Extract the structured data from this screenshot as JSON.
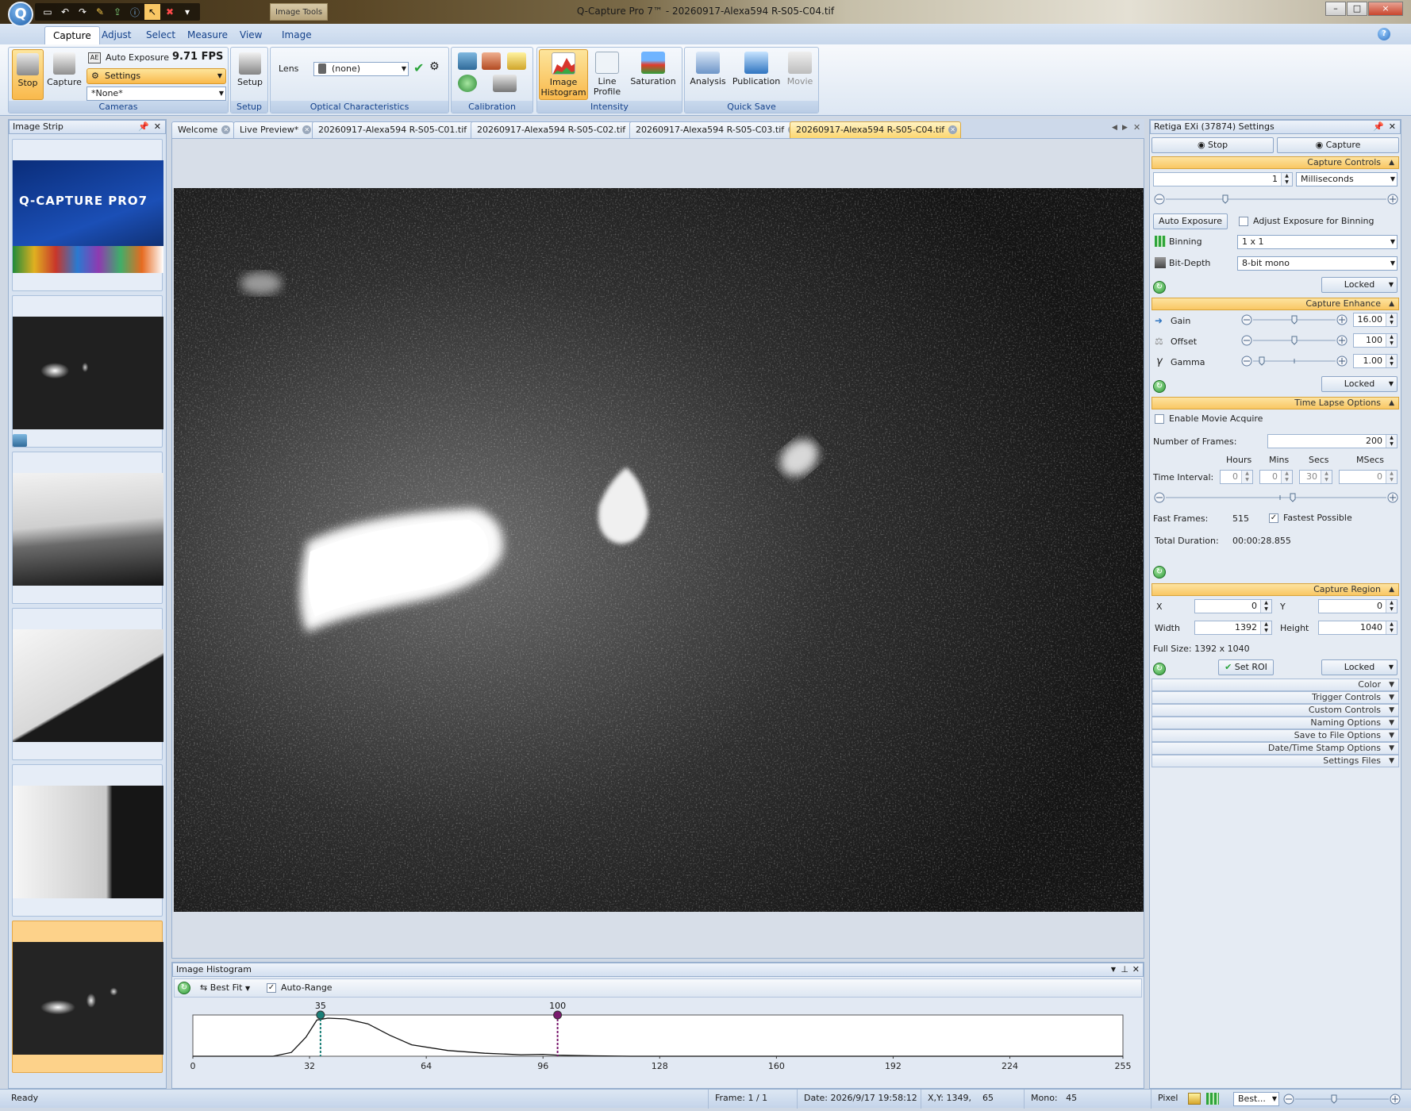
{
  "window": {
    "title": "Q-Capture Pro 7™ - 20260917-Alexa594 R-S05-C04.tif",
    "context_tab": "Image Tools",
    "controls": {
      "minimize": "–",
      "maximize": "□",
      "close": "×"
    }
  },
  "menu": {
    "tabs": [
      "Capture",
      "Adjust",
      "Select",
      "Measure",
      "View",
      "Image"
    ],
    "active": "Capture"
  },
  "ribbon": {
    "cameras": {
      "stop": "Stop",
      "capture": "Capture",
      "auto_exposure": "Auto Exposure",
      "fps": "9.71 FPS",
      "settings": "Settings",
      "preset": "*None*",
      "label": "Cameras"
    },
    "setup": {
      "button": "Setup",
      "label": "Setup"
    },
    "optical": {
      "lens_label": "Lens",
      "lens_value": "(none)",
      "label": "Optical Characteristics"
    },
    "calibration": {
      "label": "Calibration"
    },
    "intensity": {
      "image_histogram": "Image Histogram",
      "line_profile": "Line Profile",
      "saturation": "Saturation",
      "label": "Intensity"
    },
    "quicksave": {
      "analysis": "Analysis",
      "publication": "Publication",
      "movie": "Movie",
      "label": "Quick Save"
    }
  },
  "image_strip": {
    "title": "Image Strip",
    "splash_title": "Q-CAPTURE PRO7"
  },
  "doc_tabs": [
    "Welcome",
    "Live Preview*",
    "20260917-Alexa594 R-S05-C01.tif",
    "20260917-Alexa594 R-S05-C02.tif",
    "20260917-Alexa594 R-S05-C03.tif",
    "20260917-Alexa594 R-S05-C04.tif"
  ],
  "histogram": {
    "title": "Image Histogram",
    "best_fit": "Best Fit",
    "auto_range": "Auto-Range",
    "auto_range_checked": true,
    "black_marker": 35,
    "white_marker": 100,
    "marker_labels": {
      "black": "35",
      "white": "100"
    },
    "x_ticks": [
      "0",
      "32",
      "64",
      "96",
      "128",
      "160",
      "192",
      "224",
      "255"
    ],
    "x_range": [
      0,
      255
    ],
    "black_color": "#1a7f78",
    "white_color": "#7a1a6e"
  },
  "settings": {
    "title": "Retiga EXi (37874) Settings",
    "stop": "Stop",
    "capture": "Capture",
    "capture_controls": {
      "header": "Capture Controls",
      "exposure": "1",
      "unit": "Milliseconds",
      "auto_exposure": "Auto Exposure",
      "adjust_binning": "Adjust Exposure for Binning",
      "binning_label": "Binning",
      "binning": "1 x 1",
      "bitdepth_label": "Bit-Depth",
      "bitdepth": "8-bit mono",
      "locked": "Locked"
    },
    "capture_enhance": {
      "header": "Capture Enhance",
      "gain_label": "Gain",
      "gain": "16.00",
      "offset_label": "Offset",
      "offset": "100",
      "gamma_label": "Gamma",
      "gamma": "1.00",
      "locked": "Locked"
    },
    "time_lapse": {
      "header": "Time Lapse Options",
      "enable_movie": "Enable Movie Acquire",
      "frames_label": "Number of  Frames:",
      "frames": "200",
      "col_hours": "Hours",
      "col_mins": "Mins",
      "col_secs": "Secs",
      "col_msecs": "MSecs",
      "interval_label": "Time Interval:",
      "hours": "0",
      "mins": "0",
      "secs": "30",
      "msecs": "0",
      "fast_frames_label": "Fast Frames:",
      "fast_frames": "515",
      "fastest": "Fastest Possible",
      "total_label": "Total Duration:",
      "total": "00:00:28.855"
    },
    "capture_region": {
      "header": "Capture Region",
      "x_label": "X",
      "x": "0",
      "y_label": "Y",
      "y": "0",
      "width_label": "Width",
      "width": "1392",
      "height_label": "Height",
      "height": "1040",
      "full_size": "Full Size: 1392 x 1040",
      "set_roi": "Set ROI",
      "locked": "Locked"
    },
    "collapsed": [
      "Color",
      "Trigger Controls",
      "Custom Controls",
      "Naming Options",
      "Save to File Options",
      "Date/Time Stamp Options",
      "Settings Files"
    ]
  },
  "status": {
    "ready": "Ready",
    "frame": "Frame: 1 / 1",
    "date": "Date: 2026/9/17 19:58:12",
    "xy": "X,Y: 1349,    65",
    "mono": "Mono:   45",
    "pixel": "Pixel",
    "zoom": "Best..."
  }
}
